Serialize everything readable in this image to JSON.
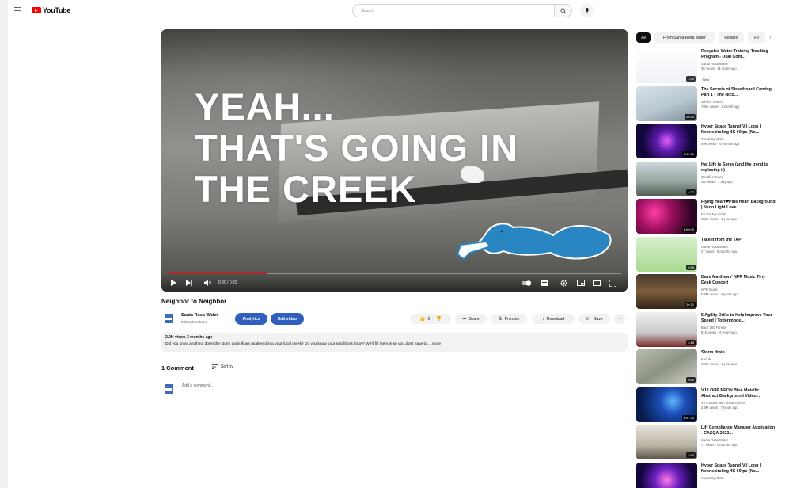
{
  "header": {
    "logo_text": "YouTube",
    "search_placeholder": "Search"
  },
  "player": {
    "overlay_lines": [
      "YEAH...",
      "THAT'S GOING IN",
      "THE CREEK"
    ],
    "time": "0:00 / 0:23",
    "progress_fraction": 0.22
  },
  "video": {
    "title": "Neighbor to Neighbor",
    "channel_name": "Santa Rosa Water",
    "channel_subs": "543 subscribers",
    "analytics_label": "Analytics",
    "edit_label": "Edit video",
    "likes": "0",
    "share_label": "Share",
    "promote_label": "Promote",
    "download_label": "Download",
    "save_label": "Save"
  },
  "description": {
    "meta": "2.9K views  3 months ago",
    "text": "Did you know anything down the storm drain flows unaltered into your local creek? Do you know your neighbors know? We'll fill them in so you don't have to. ...more"
  },
  "comments": {
    "count_label": "1 Comment",
    "sort_label": "Sort by",
    "placeholder": "Add a comment..."
  },
  "sidebar": {
    "chips": [
      "All",
      "From Santa Rosa Water",
      "Related",
      "Fo"
    ],
    "recommendations": [
      {
        "title": "Recycled Water Training Tracking Program - Dual Cont...",
        "channel": "Santa Rosa Water",
        "stats": "3K views · 11 hours ago",
        "badge": "New",
        "duration": "1:09",
        "thumb": "doc"
      },
      {
        "title": "The Secrets of Streetboard Carving: Part 1 - The Nico...",
        "channel": "Johnny Sheen",
        "stats": "706K views · 1 month ago",
        "duration": "20:24",
        "thumb": "skate"
      },
      {
        "title": "Hyper Space Tunnel V.I Loop | Neonscircling 4K 60fps (No...",
        "channel": "Visual Symbols",
        "stats": "89K views · 4 months ago",
        "duration": "1:00:00",
        "thumb": "space"
      },
      {
        "title": "Hat Life is Spray (and the trend is replacing it)",
        "channel": "Goodfer Brown",
        "stats": "3M views · 1 day ago",
        "duration": "4:27",
        "thumb": "outdoor"
      },
      {
        "title": "Flying Heart❤Pink Heart Background | Neon Light Love...",
        "channel": "EF Backgrounds",
        "stats": "955K views · 1 year ago",
        "duration": "1:00:00",
        "thumb": "hearts"
      },
      {
        "title": "Take It from the TAP!",
        "channel": "Santa Rosa Water",
        "stats": "27 views · 5 months ago",
        "duration": "0:58",
        "thumb": "cartoon"
      },
      {
        "title": "Dave Matthews' NPR Music Tiny Desk Concert",
        "channel": "NPR Music",
        "stats": "5.8M views · 4 years ago",
        "duration": "20:32",
        "thumb": "concert"
      },
      {
        "title": "5 Agility Drills to Help Improve Your Speed | Tottenmode...",
        "channel": "Back 360 Fitness",
        "stats": "81K views · 4 years ago",
        "duration": "3:18",
        "thumb": "gym"
      },
      {
        "title": "Storm drain",
        "channel": "Ken W",
        "stats": "123K views · 1 year ago",
        "duration": "0:52",
        "thumb": "drain"
      },
      {
        "title": "VJ LOOP NEON Blue Metallic Abstract Background Video...",
        "channel": "VJ & Music with Visual Effects",
        "stats": "2.9M views · 7 years ago",
        "duration": "1:07:33",
        "thumb": "neonblue"
      },
      {
        "title": "Lift Compliance Manager Application - CASQA 2023...",
        "channel": "Santa Rosa Water",
        "stats": "71 views · 4 months ago",
        "duration": "3:09",
        "thumb": "office"
      },
      {
        "title": "Hyper Space Tunnel V.I Loop | Neonscircling 4K 60fps (No...",
        "channel": "Visual Symbols",
        "stats": "",
        "duration": "",
        "thumb": "space2"
      }
    ]
  },
  "colors": {
    "accent_red": "#ff0000",
    "brand_blue": "#2f5fbf",
    "squirrel_blue": "#2a86c3"
  }
}
